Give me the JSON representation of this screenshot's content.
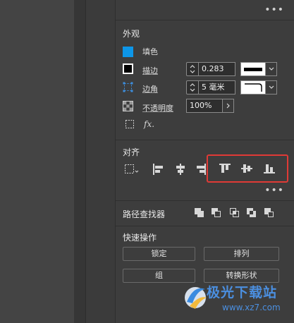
{
  "panel": {
    "more_glyph": "•••",
    "appearance": {
      "title": "外观",
      "fill_label": "填色",
      "stroke_label": "描边",
      "stroke_value": "0.283",
      "corner_label": "边角",
      "corner_value": "5 毫米",
      "opacity_label": "不透明度",
      "opacity_value": "100%",
      "fx_label": "fx."
    },
    "align": {
      "title": "对齐"
    },
    "pathfinder": {
      "title": "路径查找器"
    },
    "quick_actions": {
      "title": "快速操作",
      "lock_label": "锁定",
      "arrange_label": "排列",
      "group_label": "组",
      "convert_shape_label": "转换形状"
    }
  },
  "watermark": {
    "title": "极光下载站",
    "url": "www.xz7.com"
  },
  "colors": {
    "fill": "#0d96e8",
    "highlight": "#e03a36",
    "watermark": "#4b8fe0"
  }
}
